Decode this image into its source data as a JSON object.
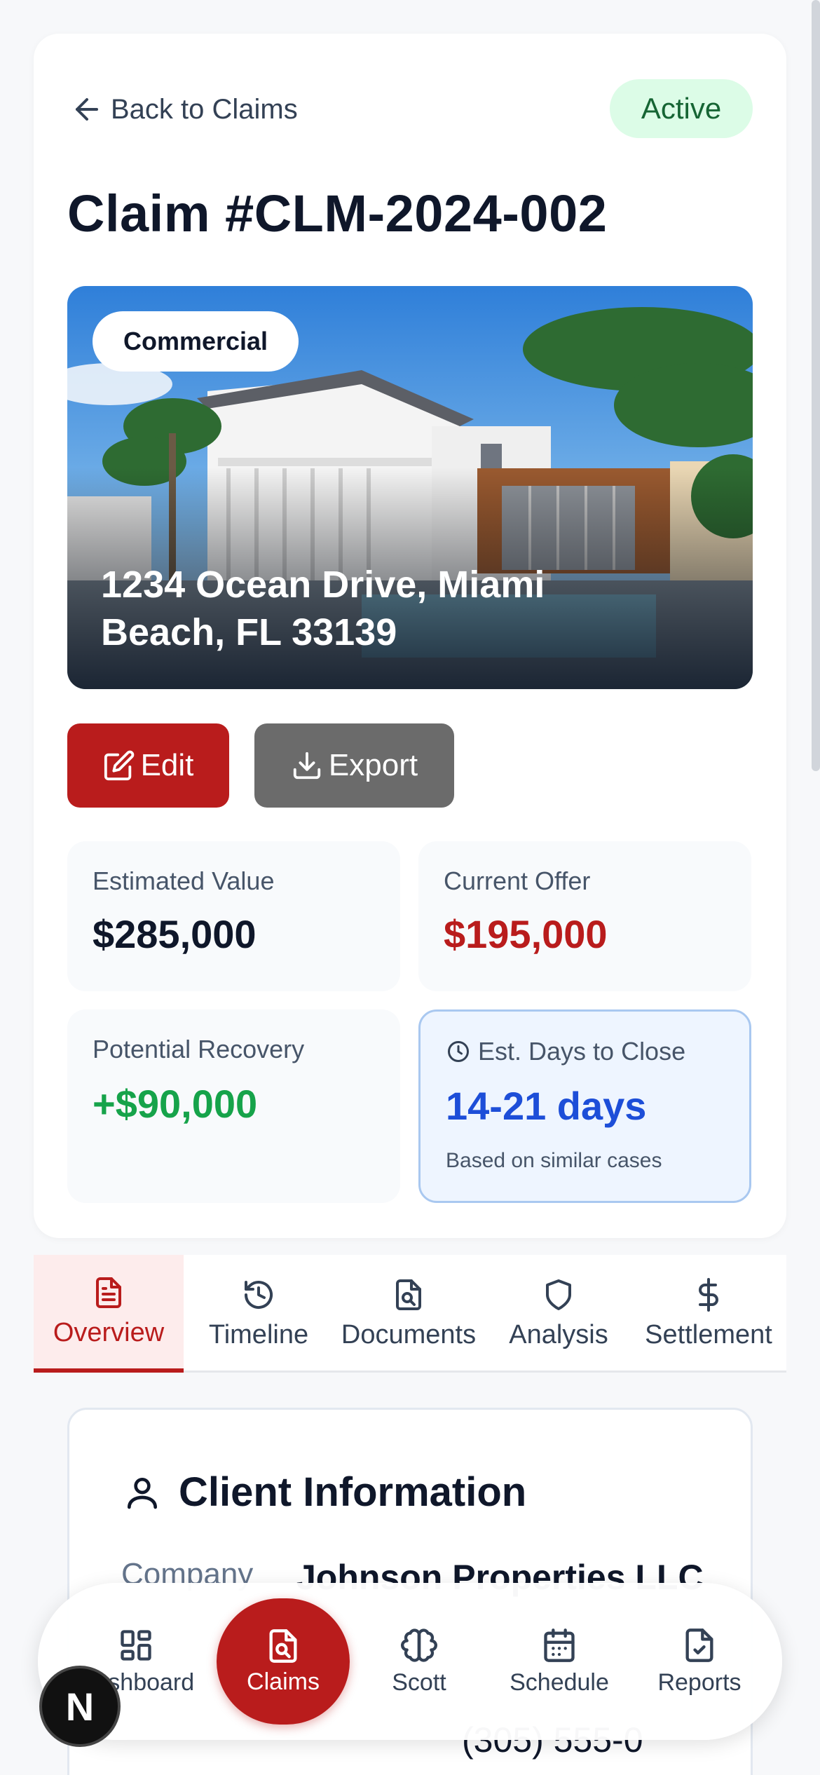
{
  "header": {
    "back_label": "Back to Claims",
    "status": "Active",
    "title": "Claim #CLM-2024-002"
  },
  "property": {
    "type_badge": "Commercial",
    "address": "1234 Ocean Drive, Miami Beach, FL 33139"
  },
  "actions": {
    "edit_label": "Edit",
    "export_label": "Export"
  },
  "stats": {
    "estimated_value_label": "Estimated Value",
    "estimated_value": "$285,000",
    "current_offer_label": "Current Offer",
    "current_offer": "$195,000",
    "potential_recovery_label": "Potential Recovery",
    "potential_recovery": "+$90,000",
    "days_to_close_label": "Est. Days to Close",
    "days_to_close": "14-21 days",
    "days_note": "Based on similar cases"
  },
  "tabs": [
    {
      "label": "Overview",
      "icon": "document-icon",
      "active": true
    },
    {
      "label": "Timeline",
      "icon": "history-icon",
      "active": false
    },
    {
      "label": "Documents",
      "icon": "file-search-icon",
      "active": false
    },
    {
      "label": "Analysis",
      "icon": "shield-icon",
      "active": false
    },
    {
      "label": "Settlement",
      "icon": "dollar-icon",
      "active": false
    }
  ],
  "client_info": {
    "heading": "Client Information",
    "company_label": "Company",
    "company_value": "Johnson Properties LLC",
    "phone_partial": "(305) 555-0"
  },
  "bottom_nav": [
    {
      "label": "Dashboard",
      "icon": "grid-icon"
    },
    {
      "label": "Claims",
      "icon": "file-search-icon"
    },
    {
      "label": "Scott",
      "icon": "brain-icon"
    },
    {
      "label": "Schedule",
      "icon": "calendar-icon"
    },
    {
      "label": "Reports",
      "icon": "file-check-icon"
    }
  ],
  "floating_logo": "N",
  "colors": {
    "brand_red": "#b91c1c",
    "success_green": "#16a34a",
    "info_blue": "#1d4ed8",
    "active_badge_bg": "#dcfce7"
  }
}
